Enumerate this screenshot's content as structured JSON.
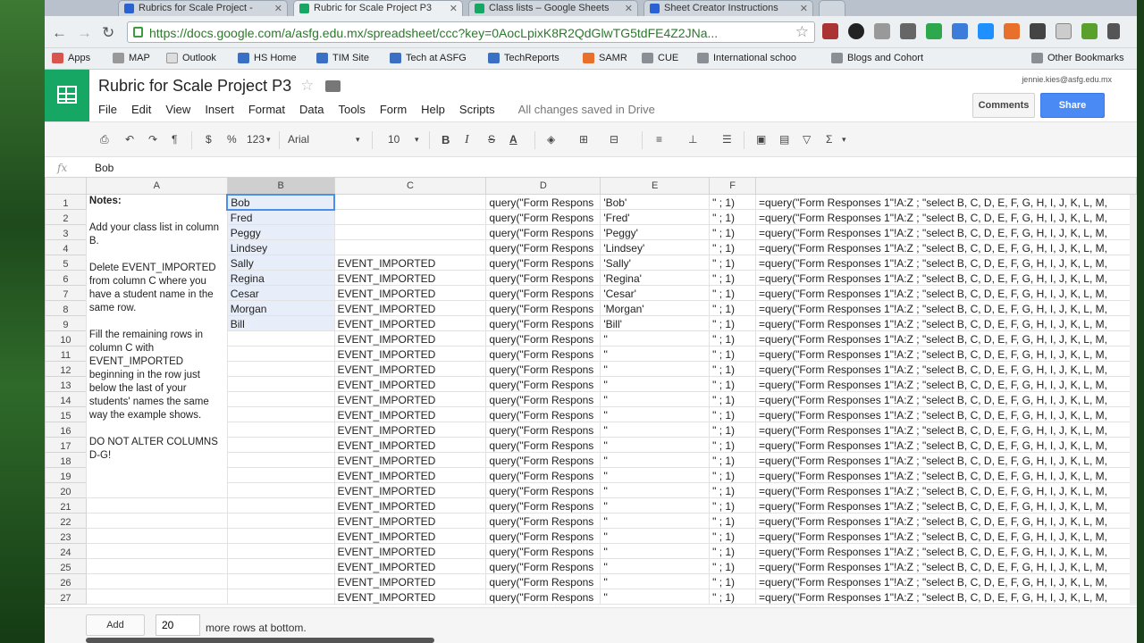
{
  "tabs": [
    {
      "title": "Rubrics for Scale Project -",
      "color": "#2a62d4"
    },
    {
      "title": "Rubric for Scale Project P3",
      "color": "#16a765"
    },
    {
      "title": "Class lists – Google Sheets",
      "color": "#16a765"
    },
    {
      "title": "Sheet Creator Instructions",
      "color": "#2a62d4"
    }
  ],
  "url": "https://docs.google.com/a/asfg.edu.mx/spreadsheet/ccc?key=0AocLpixK8R2QdGlwTG5tdFE4Z2JNa...",
  "bookmarks": [
    "Apps",
    "MAP",
    "Outlook",
    "HS Home",
    "TIM Site",
    "Tech at ASFG",
    "TechReports",
    "SAMR",
    "CUE",
    "International schoo",
    "Blogs and Cohort",
    "Other Bookmarks"
  ],
  "doc": {
    "title": "Rubric for Scale Project P3",
    "account": "jennie.kies@asfg.edu.mx",
    "comments": "Comments",
    "share": "Share",
    "saved": "All changes saved in Drive"
  },
  "menu": [
    "File",
    "Edit",
    "View",
    "Insert",
    "Format",
    "Data",
    "Tools",
    "Form",
    "Help",
    "Scripts"
  ],
  "toolbar": {
    "currency": "$",
    "percent": "%",
    "number_format": "123",
    "font": "Arial",
    "size": "10",
    "bold": "B",
    "italic": "I",
    "strike": "S",
    "textcolor": "A",
    "sum": "Σ"
  },
  "formula": {
    "fx": "fx",
    "value": "Bob"
  },
  "columns": [
    "A",
    "B",
    "C",
    "D",
    "E",
    "F",
    ""
  ],
  "notes": {
    "title": "Notes:",
    "p1": "Add your class list in column B.",
    "p2": "Delete EVENT_IMPORTED from column C where you have a student name in the same row.",
    "p3": "Fill the remaining rows in column C with EVENT_IMPORTED beginning in the row just below the last of your students' names the same way the example shows.",
    "p4": "DO NOT ALTER COLUMNS D-G!"
  },
  "rows": [
    {
      "n": "1",
      "b": "Bob",
      "c": "",
      "d": "query(\"Form Respons",
      "e": "'Bob'",
      "f": "\" ; 1)",
      "g": "=query(\"Form Responses 1\"!A:Z ; \"select B, C, D, E, F, G, H, I, J, K, L, M,"
    },
    {
      "n": "2",
      "b": "Fred",
      "c": "",
      "d": "query(\"Form Respons",
      "e": "'Fred'",
      "f": "\" ; 1)",
      "g": "=query(\"Form Responses 1\"!A:Z ; \"select B, C, D, E, F, G, H, I, J, K, L, M,"
    },
    {
      "n": "3",
      "b": "Peggy",
      "c": "",
      "d": "query(\"Form Respons",
      "e": "'Peggy'",
      "f": "\" ; 1)",
      "g": "=query(\"Form Responses 1\"!A:Z ; \"select B, C, D, E, F, G, H, I, J, K, L, M,"
    },
    {
      "n": "4",
      "b": "Lindsey",
      "c": "",
      "d": "query(\"Form Respons",
      "e": "'Lindsey'",
      "f": "\" ; 1)",
      "g": "=query(\"Form Responses 1\"!A:Z ; \"select B, C, D, E, F, G, H, I, J, K, L, M,"
    },
    {
      "n": "5",
      "b": "Sally",
      "c": "EVENT_IMPORTED",
      "d": "query(\"Form Respons",
      "e": "'Sally'",
      "f": "\" ; 1)",
      "g": "=query(\"Form Responses 1\"!A:Z ; \"select B, C, D, E, F, G, H, I, J, K, L, M,"
    },
    {
      "n": "6",
      "b": "Regina",
      "c": "EVENT_IMPORTED",
      "d": "query(\"Form Respons",
      "e": "'Regina'",
      "f": "\" ; 1)",
      "g": "=query(\"Form Responses 1\"!A:Z ; \"select B, C, D, E, F, G, H, I, J, K, L, M,"
    },
    {
      "n": "7",
      "b": "Cesar",
      "c": "EVENT_IMPORTED",
      "d": "query(\"Form Respons",
      "e": "'Cesar'",
      "f": "\" ; 1)",
      "g": "=query(\"Form Responses 1\"!A:Z ; \"select B, C, D, E, F, G, H, I, J, K, L, M,"
    },
    {
      "n": "8",
      "b": "Morgan",
      "c": "EVENT_IMPORTED",
      "d": "query(\"Form Respons",
      "e": "'Morgan'",
      "f": "\" ; 1)",
      "g": "=query(\"Form Responses 1\"!A:Z ; \"select B, C, D, E, F, G, H, I, J, K, L, M,"
    },
    {
      "n": "9",
      "b": "Bill",
      "c": "EVENT_IMPORTED",
      "d": "query(\"Form Respons",
      "e": "'Bill'",
      "f": "\" ; 1)",
      "g": "=query(\"Form Responses 1\"!A:Z ; \"select B, C, D, E, F, G, H, I, J, K, L, M,"
    },
    {
      "n": "10",
      "b": "",
      "c": "EVENT_IMPORTED",
      "d": "query(\"Form Respons",
      "e": "''",
      "f": "\" ; 1)",
      "g": "=query(\"Form Responses 1\"!A:Z ; \"select B, C, D, E, F, G, H, I, J, K, L, M,"
    },
    {
      "n": "11",
      "b": "",
      "c": "EVENT_IMPORTED",
      "d": "query(\"Form Respons",
      "e": "''",
      "f": "\" ; 1)",
      "g": "=query(\"Form Responses 1\"!A:Z ; \"select B, C, D, E, F, G, H, I, J, K, L, M,"
    },
    {
      "n": "12",
      "b": "",
      "c": "EVENT_IMPORTED",
      "d": "query(\"Form Respons",
      "e": "''",
      "f": "\" ; 1)",
      "g": "=query(\"Form Responses 1\"!A:Z ; \"select B, C, D, E, F, G, H, I, J, K, L, M,"
    },
    {
      "n": "13",
      "b": "",
      "c": "EVENT_IMPORTED",
      "d": "query(\"Form Respons",
      "e": "''",
      "f": "\" ; 1)",
      "g": "=query(\"Form Responses 1\"!A:Z ; \"select B, C, D, E, F, G, H, I, J, K, L, M,"
    },
    {
      "n": "14",
      "b": "",
      "c": "EVENT_IMPORTED",
      "d": "query(\"Form Respons",
      "e": "''",
      "f": "\" ; 1)",
      "g": "=query(\"Form Responses 1\"!A:Z ; \"select B, C, D, E, F, G, H, I, J, K, L, M,"
    },
    {
      "n": "15",
      "b": "",
      "c": "EVENT_IMPORTED",
      "d": "query(\"Form Respons",
      "e": "''",
      "f": "\" ; 1)",
      "g": "=query(\"Form Responses 1\"!A:Z ; \"select B, C, D, E, F, G, H, I, J, K, L, M,"
    },
    {
      "n": "16",
      "b": "",
      "c": "EVENT_IMPORTED",
      "d": "query(\"Form Respons",
      "e": "''",
      "f": "\" ; 1)",
      "g": "=query(\"Form Responses 1\"!A:Z ; \"select B, C, D, E, F, G, H, I, J, K, L, M,"
    },
    {
      "n": "17",
      "b": "",
      "c": "EVENT_IMPORTED",
      "d": "query(\"Form Respons",
      "e": "''",
      "f": "\" ; 1)",
      "g": "=query(\"Form Responses 1\"!A:Z ; \"select B, C, D, E, F, G, H, I, J, K, L, M,"
    },
    {
      "n": "18",
      "b": "",
      "c": "EVENT_IMPORTED",
      "d": "query(\"Form Respons",
      "e": "''",
      "f": "\" ; 1)",
      "g": "=query(\"Form Responses 1\"!A:Z ; \"select B, C, D, E, F, G, H, I, J, K, L, M,"
    },
    {
      "n": "19",
      "b": "",
      "c": "EVENT_IMPORTED",
      "d": "query(\"Form Respons",
      "e": "''",
      "f": "\" ; 1)",
      "g": "=query(\"Form Responses 1\"!A:Z ; \"select B, C, D, E, F, G, H, I, J, K, L, M,"
    },
    {
      "n": "20",
      "b": "",
      "c": "EVENT_IMPORTED",
      "d": "query(\"Form Respons",
      "e": "''",
      "f": "\" ; 1)",
      "g": "=query(\"Form Responses 1\"!A:Z ; \"select B, C, D, E, F, G, H, I, J, K, L, M,"
    },
    {
      "n": "21",
      "b": "",
      "c": "EVENT_IMPORTED",
      "d": "query(\"Form Respons",
      "e": "''",
      "f": "\" ; 1)",
      "g": "=query(\"Form Responses 1\"!A:Z ; \"select B, C, D, E, F, G, H, I, J, K, L, M,"
    },
    {
      "n": "22",
      "b": "",
      "c": "EVENT_IMPORTED",
      "d": "query(\"Form Respons",
      "e": "''",
      "f": "\" ; 1)",
      "g": "=query(\"Form Responses 1\"!A:Z ; \"select B, C, D, E, F, G, H, I, J, K, L, M,"
    },
    {
      "n": "23",
      "b": "",
      "c": "EVENT_IMPORTED",
      "d": "query(\"Form Respons",
      "e": "''",
      "f": "\" ; 1)",
      "g": "=query(\"Form Responses 1\"!A:Z ; \"select B, C, D, E, F, G, H, I, J, K, L, M,"
    },
    {
      "n": "24",
      "b": "",
      "c": "EVENT_IMPORTED",
      "d": "query(\"Form Respons",
      "e": "''",
      "f": "\" ; 1)",
      "g": "=query(\"Form Responses 1\"!A:Z ; \"select B, C, D, E, F, G, H, I, J, K, L, M,"
    },
    {
      "n": "25",
      "b": "",
      "c": "EVENT_IMPORTED",
      "d": "query(\"Form Respons",
      "e": "''",
      "f": "\" ; 1)",
      "g": "=query(\"Form Responses 1\"!A:Z ; \"select B, C, D, E, F, G, H, I, J, K, L, M,"
    },
    {
      "n": "26",
      "b": "",
      "c": "EVENT_IMPORTED",
      "d": "query(\"Form Respons",
      "e": "''",
      "f": "\" ; 1)",
      "g": "=query(\"Form Responses 1\"!A:Z ; \"select B, C, D, E, F, G, H, I, J, K, L, M,"
    },
    {
      "n": "27",
      "b": "",
      "c": "EVENT_IMPORTED",
      "d": "query(\"Form Respons",
      "e": "''",
      "f": "\" ; 1)",
      "g": "=query(\"Form Responses 1\"!A:Z ; \"select B, C, D, E, F, G, H, I, J, K, L, M,"
    }
  ],
  "bottom": {
    "add": "Add",
    "rows_value": "20",
    "rows_label": "more rows at bottom."
  },
  "colors": {
    "sheets_green": "#16a765",
    "share_blue": "#4a8af4",
    "selection": "#e8eef9"
  }
}
